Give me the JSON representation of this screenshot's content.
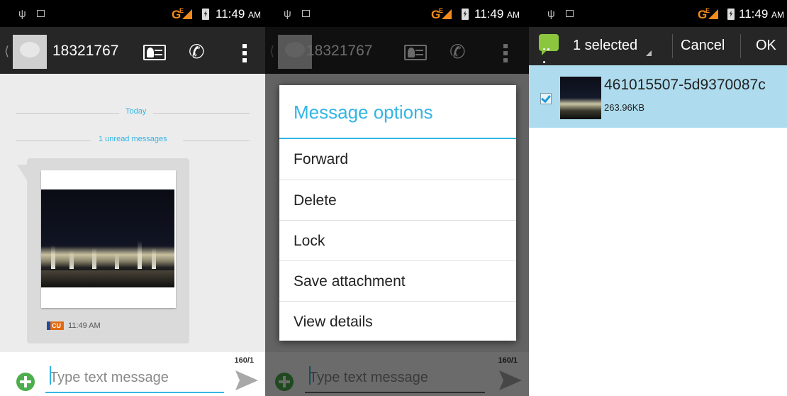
{
  "status_bar": {
    "time": "11:49",
    "ampm": "AM",
    "network": "G",
    "network_sub": "E"
  },
  "conversation": {
    "contact_number": "18321767",
    "today_label": "Today",
    "unread_label": "1 unread messages",
    "operator_badge": "CU",
    "message_time": "11:49 AM",
    "compose_placeholder": "Type text message",
    "char_count": "160/1"
  },
  "message_options": {
    "title": "Message options",
    "items": [
      "Forward",
      "Delete",
      "Lock",
      "Save attachment",
      "View details"
    ]
  },
  "selection": {
    "count_label": "1 selected",
    "cancel_label": "Cancel",
    "ok_label": "OK",
    "attachment": {
      "name": "461015507-5d9370087c",
      "size": "263.96KB",
      "checked": true
    }
  },
  "colors": {
    "accent": "#33b5e5",
    "action_bar": "#262626",
    "selected_row": "#aedcee",
    "add_button": "#4cae4c"
  }
}
